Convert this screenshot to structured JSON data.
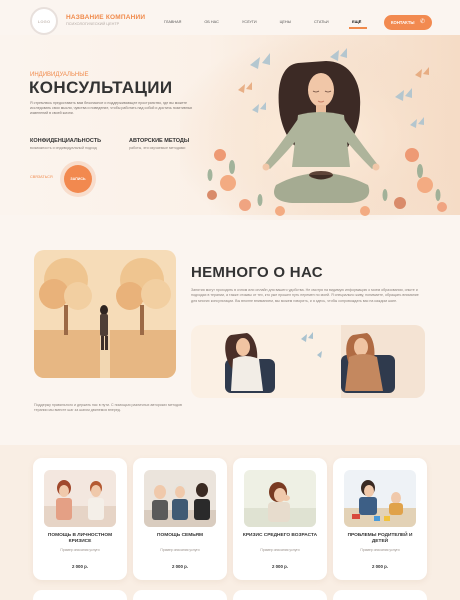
{
  "header": {
    "logo_text": "LOGO",
    "brand_name": "НАЗВАНИЕ КОМПАНИИ",
    "brand_sub": "ПСИХОЛОГИЧЕСКИЙ ЦЕНТР",
    "nav": [
      "ГЛАВНАЯ",
      "ОБ НАС",
      "УСЛУГИ",
      "ЦЕНЫ",
      "СТАТЬИ"
    ],
    "active": "ЕЩЁ",
    "contact_label": "КОНТАКТЫ",
    "contact_icon": "phone-icon"
  },
  "hero": {
    "kicker": "ИНДИВИДУАЛЬНЫЕ",
    "title": "КОНСУЛЬТАЦИИ",
    "text": "Я стремлюсь предоставить вам безопасное и поддерживающее пространство, где вы можете исследовать свои мысли, чувства и поведение, чтобы работать над собой и достичь позитивных изменений в своей жизни.",
    "features": [
      {
        "title": "КОНФИДЕНЦИАЛЬНОСТЬ",
        "text": "возможность и индивидуальный подход"
      },
      {
        "title": "АВТОРСКИЕ МЕТОДЫ",
        "text": "работы, эти изучаемые методами"
      }
    ],
    "more_link": "СВЯЗАТЬСЯ",
    "play_label": "ЗАПИСЬ"
  },
  "about": {
    "title": "НЕМНОГО О НАС",
    "text": "Занятия могут проходить в очном или онлайн для вашего удобства. Не смотря на видимую информацию о моем образовании, опыте и подходах в терапии, а также отзывы от тех, кто уже прошел путь перемен по моей. Я специально живу, понимаете, обращать внимание для многих консультации. Вы вполне вниманием, мы можем говорить, и я здесь, чтобы сопровождать вас на каждом шаге.",
    "note": "Поддержу правильного и держать нас в пути. С помощью различных авторских методов терапии мы вместе шаг за шагом двинемся вперед."
  },
  "services": [
    {
      "title": "ПОМОЩЬ В ЛИЧНОСТНОМ КРИЗИСЕ",
      "example": "Пример описания услуги",
      "price": "2 000 р."
    },
    {
      "title": "ПОМОЩЬ СЕМЬЯМ",
      "example": "Пример описания услуги",
      "price": "2 000 р."
    },
    {
      "title": "КРИЗИС СРЕДНЕГО ВОЗРАСТА",
      "example": "Пример описания услуги",
      "price": "2 000 р."
    },
    {
      "title": "ПРОБЛЕМЫ РОДИТЕЛЕЙ И ДЕТЕЙ",
      "example": "Пример описания услуги",
      "price": "2 000 р."
    }
  ],
  "colors": {
    "accent": "#f08a4b",
    "bg": "#fbf5f0",
    "heading": "#333333"
  }
}
